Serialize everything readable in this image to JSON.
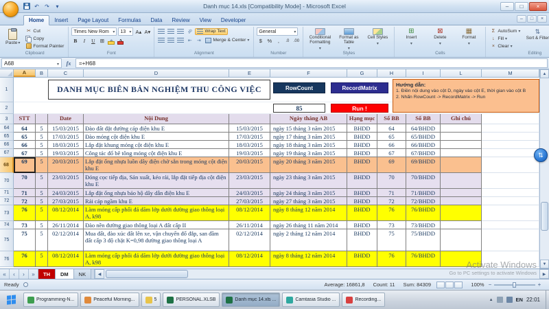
{
  "window": {
    "title": "Danh mục 14.xls [Compatibility Mode] - Microsoft Excel"
  },
  "icons": {
    "undo": "↶",
    "redo": "↷",
    "dropdown": "▾",
    "minimize": "–",
    "restore": "□",
    "close": "×",
    "scissors": "✂",
    "bold": "B",
    "italic": "I",
    "underline": "U",
    "grow_font": "A▴",
    "shrink_font": "A▾",
    "borders": "⊞",
    "font_color": "A",
    "dollar": "$",
    "percent": "%",
    "comma": ",",
    "dec_inc": ".0",
    "dec_dec": ".00",
    "sigma": "Σ",
    "fill_down": "↓",
    "clear_x": "×",
    "sort": "⇅",
    "find": "◎",
    "fx": "fx",
    "widget": "⇅",
    "tray_up": "▲",
    "nav_first": "«",
    "nav_prev": "‹",
    "nav_next": "›",
    "nav_last": "»",
    "zoom_out": "−",
    "zoom_in": "+"
  },
  "ribbon": {
    "tabs": [
      {
        "label": "Home",
        "active": true
      },
      {
        "label": "Insert"
      },
      {
        "label": "Page Layout"
      },
      {
        "label": "Formulas"
      },
      {
        "label": "Data"
      },
      {
        "label": "Review"
      },
      {
        "label": "View"
      },
      {
        "label": "Developer"
      }
    ],
    "clipboard": {
      "label": "Clipboard",
      "paste": "Paste",
      "cut": "Cut",
      "copy": "Copy",
      "format_painter": "Format Painter"
    },
    "font": {
      "label": "Font",
      "name": "Times New Rom",
      "size": "13"
    },
    "alignment": {
      "label": "Alignment",
      "wrap_text": "Wrap Text",
      "merge_center": "Merge & Center"
    },
    "number": {
      "label": "Number",
      "format": "General"
    },
    "styles": {
      "label": "Styles",
      "items": [
        "Conditional Formatting",
        "Format as Table",
        "Cell Styles"
      ]
    },
    "cells": {
      "label": "Cells",
      "items": [
        "Insert",
        "Delete",
        "Format"
      ],
      "icons": [
        "⊞",
        "⊠",
        "▦"
      ]
    },
    "editing": {
      "label": "Editing",
      "autosum": "AutoSum",
      "fill": "Fill",
      "clear": "Clear",
      "sort_filter": "Sort & Filter",
      "find_select": "Find & Select"
    }
  },
  "formula_bar": {
    "name_box": "A68",
    "formula": "=+H68"
  },
  "sheet": {
    "column_letters": [
      "A",
      "B",
      "C",
      "D",
      "E",
      "F",
      "G",
      "H",
      "I",
      "L",
      "M"
    ],
    "row1_number": "1",
    "row2_number": "2",
    "header_row_number": "3",
    "title": "DANH MỤC BIÊN BẢN NGHIỆM THU CÔNG VIỆC",
    "rowcount_button": "RowCount",
    "recordmatrix_button": "RecordMatrix",
    "count_value": "85",
    "run_button": "Run !",
    "instructions": {
      "heading": "Hướng dẫn:",
      "line1": "1. Điền nội dung vào cột D, ngày vào cột E, thời gian vào cột B",
      "line2": "2. Nhấn RowCount -> RecordMatrix -> Run"
    },
    "header_cells": [
      "STT",
      "",
      "Date",
      "Nội Dung",
      "",
      "Ngày tháng AB",
      "Hạng mục",
      "Số BB",
      "Số BB",
      "Ghi chú"
    ],
    "rows": [
      {
        "n": "64",
        "lines": 1,
        "hl": "white",
        "cells": [
          "64",
          "5",
          "15/03/2015",
          "Đào đất đặt đường cáp điện khu E",
          "15/03/2015",
          "ngày 15 tháng 3 năm 2015",
          "BHDD",
          "64",
          "64/BHDD",
          ""
        ]
      },
      {
        "n": "65",
        "lines": 1,
        "hl": "white",
        "cells": [
          "65",
          "5",
          "17/03/2015",
          "Đào móng cột điện khu E",
          "17/03/2015",
          "ngày 17 tháng 3 năm 2015",
          "BHDD",
          "65",
          "65/BHDD",
          ""
        ]
      },
      {
        "n": "66",
        "lines": 1,
        "hl": "white",
        "cells": [
          "66",
          "5",
          "18/03/2015",
          "Lắp đặt khung móng cột điện khu E",
          "18/03/2015",
          "ngày 18 tháng 3 năm 2015",
          "BHDD",
          "66",
          "66/BHDD",
          ""
        ]
      },
      {
        "n": "67",
        "lines": 1,
        "hl": "white",
        "cells": [
          "67",
          "5",
          "19/03/2015",
          "Công tác đổ bê tông móng cột điện khu E",
          "19/03/2015",
          "ngày 19 tháng 3 năm 2015",
          "BHDD",
          "67",
          "67/BHDD",
          ""
        ]
      },
      {
        "n": "68",
        "lines": 2,
        "hl": "orange",
        "selected": true,
        "cells": [
          "69",
          "5",
          "20/03/2015",
          "Lắp đặt ống nhựa luồn dây điện chờ sẵn trong móng cột điện khu E",
          "20/03/2015",
          "ngày 20 tháng 3 năm 2015",
          "BHDD",
          "69",
          "69/BHDD",
          ""
        ]
      },
      {
        "n": "70",
        "lines": 2,
        "hl": "lav",
        "cells": [
          "70",
          "5",
          "23/03/2015",
          "Đóng cọc tiếp địa, Sản xuất, kéo rải, lắp đặt tiếp địa cột điện khu E",
          "23/03/2015",
          "ngày 23 tháng 3 năm 2015",
          "BHDD",
          "70",
          "70/BHDD",
          ""
        ]
      },
      {
        "n": "71",
        "lines": 1,
        "hl": "lav",
        "cells": [
          "71",
          "5",
          "24/03/2015",
          "Lắp đặt ống nhựa bảo hộ dây dẫn điện khu E",
          "24/03/2015",
          "ngày 24 tháng 3 năm 2015",
          "BHDD",
          "71",
          "71/BHDD",
          ""
        ]
      },
      {
        "n": "72",
        "lines": 1,
        "hl": "lav",
        "cells": [
          "72",
          "5",
          "27/03/2015",
          "Rải cáp ngầm khu E",
          "27/03/2015",
          "ngày 27 tháng 3 năm 2015",
          "BHDD",
          "72",
          "72/BHDD",
          ""
        ]
      },
      {
        "n": "73",
        "lines": 2,
        "hl": "yellow",
        "cells": [
          "76",
          "5",
          "08/12/2014",
          "Làm móng cấp phối đá dăm lớp dưới đường giao thông loại A, k98",
          "08/12/2014",
          "ngày 8 tháng 12 năm 2014",
          "BHDD",
          "76",
          "76/BHDD",
          ""
        ]
      },
      {
        "n": "74",
        "lines": 1,
        "hl": "white",
        "cells": [
          "73",
          "5",
          "26/11/2014",
          "Đào nền đường giao thông loại A  đất cấp II",
          "26/11/2014",
          "ngày 26 tháng 11 năm 2014",
          "BHDD",
          "73",
          "73/BHDD",
          ""
        ]
      },
      {
        "n": "75",
        "lines": 3,
        "hl": "white",
        "cells": [
          "75",
          "5",
          "02/12/2014",
          "Mua đất, đào xúc đất lên xe, vận chuyển đổ đắp, san đầm đất cấp 3 độ chặt K=0,98 đường giao thông loại A",
          "02/12/2014",
          "ngày 2 tháng 12 năm 2014",
          "BHDD",
          "75",
          "75/BHDD",
          ""
        ]
      },
      {
        "n": "76",
        "lines": 2,
        "hl": "yellow",
        "cells": [
          "76",
          "5",
          "08/12/2014",
          "Làm móng cấp phối đá dăm lớp dưới đường giao thông loại A, k98",
          "08/12/2014",
          "ngày 8 tháng 12 năm 2014",
          "BHDD",
          "76",
          "76/BHDD",
          ""
        ]
      }
    ]
  },
  "sheet_tabs": [
    {
      "label": "TH",
      "style": "red"
    },
    {
      "label": "DM",
      "style": "active"
    },
    {
      "label": "NK",
      "style": ""
    }
  ],
  "status_bar": {
    "mode": "Ready",
    "average": "Average: 16861,8",
    "count": "Count: 11",
    "sum": "Sum: 84309",
    "zoom": "100%"
  },
  "taskbar": {
    "items": [
      {
        "label": "Programming-N...",
        "color": "#3E9E4F"
      },
      {
        "label": "Peaceful Morning...",
        "color": "#E08A3C"
      },
      {
        "label": "5",
        "color": "#E8C44A"
      },
      {
        "label": "PERSONAL.XLSB",
        "color": "#1E7145"
      },
      {
        "label": "Danh mục 14.xls ...",
        "color": "#1E7145",
        "active": true
      },
      {
        "label": "Camtasia Studio ...",
        "color": "#2FA8A0"
      },
      {
        "label": "Recording...",
        "color": "#D84040"
      }
    ],
    "tray": {
      "language": "EN",
      "time": "22:01"
    }
  },
  "watermark": {
    "line1": "Activate Windows",
    "line2": "Go to PC settings to activate Windows"
  }
}
